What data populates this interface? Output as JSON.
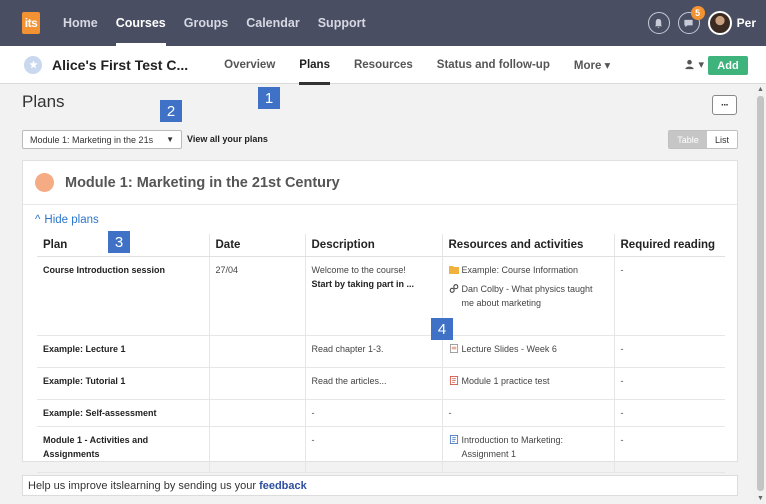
{
  "topbar": {
    "logo_text": "its",
    "nav": [
      "Home",
      "Courses",
      "Groups",
      "Calendar",
      "Support"
    ],
    "active_nav": "Courses",
    "messages_badge": "5",
    "username": "Per"
  },
  "course": {
    "title": "Alice's First Test C...",
    "tabs": [
      "Overview",
      "Plans",
      "Resources",
      "Status and follow-up",
      "More ▾"
    ],
    "active_tab": "Plans",
    "add_label": "Add"
  },
  "page": {
    "title": "Plans",
    "more_label": "···",
    "module_select_value": "Module 1: Marketing in the 21s",
    "view_all_label": "View all your plans",
    "toggle_table": "Table",
    "toggle_list": "List"
  },
  "module": {
    "heading": "Module 1: Marketing in the 21st Century",
    "hide_plans_label": "Hide plans",
    "columns": [
      "Plan",
      "Date",
      "Description",
      "Resources and activities",
      "Required reading"
    ],
    "rows": [
      {
        "plan": "Course Introduction session",
        "date": "27/04",
        "description": "Welcome to the course!",
        "description_bold": "Start by taking part in ...",
        "resources": [
          {
            "icon": "folder-icon",
            "text": "Example: Course Information"
          },
          {
            "icon": "link-icon",
            "text": "Dan Colby - What physics taught me about marketing"
          }
        ],
        "reading": "-"
      },
      {
        "plan": "Example: Lecture 1",
        "date": "",
        "description": "Read chapter 1-3.",
        "description_bold": "",
        "resources": [
          {
            "icon": "slides-icon",
            "text": "Lecture Slides - Week 6"
          }
        ],
        "reading": "-"
      },
      {
        "plan": "Example: Tutorial 1",
        "date": "",
        "description": "Read the articles...",
        "description_bold": "",
        "resources": [
          {
            "icon": "test-icon",
            "text": "Module 1 practice test"
          }
        ],
        "reading": "-"
      },
      {
        "plan": "Example: Self-assessment",
        "date": "",
        "description": "-",
        "description_bold": "",
        "resources": [
          {
            "icon": "",
            "text": "-"
          }
        ],
        "reading": "-"
      },
      {
        "plan": "Module 1 - Activities and Assignments",
        "date": "",
        "description": "-",
        "description_bold": "",
        "resources": [
          {
            "icon": "assignment-icon",
            "text": "Introduction to Marketing: Assignment 1"
          }
        ],
        "reading": "-"
      }
    ]
  },
  "markers": [
    "1",
    "2",
    "3",
    "4"
  ],
  "feedback": {
    "text": "Help us improve itslearning by sending us your",
    "link": "feedback"
  },
  "colors": {
    "topbar": "#4a4e63",
    "accent_orange": "#f39233",
    "add_green": "#3fb37c",
    "link_blue": "#2c76c9",
    "marker_blue": "#3f72c6",
    "module_dot": "#f5ab84"
  }
}
